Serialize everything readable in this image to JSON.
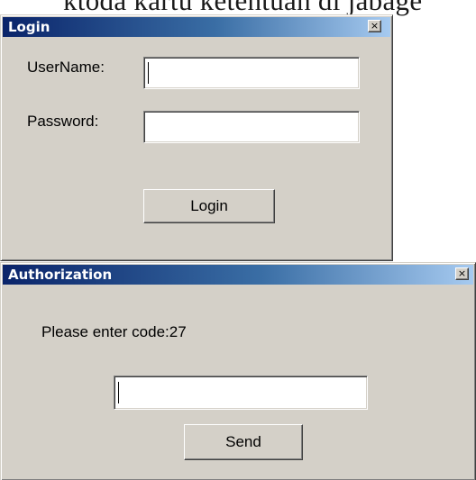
{
  "background": {
    "partial_text": "ktoda kartu ketentuan di jabage"
  },
  "login_window": {
    "title": "Login",
    "close_glyph": "×",
    "username_label": "UserName:",
    "username_value": "",
    "password_label": "Password:",
    "password_value": "",
    "login_button": "Login"
  },
  "auth_window": {
    "title": "Authorization",
    "close_glyph": "×",
    "prompt": "Please enter code:27",
    "code_value": "",
    "send_button": "Send"
  },
  "colors": {
    "window_face": "#d4d0c8",
    "titlebar_start": "#0a246a",
    "titlebar_end": "#a6caf0",
    "titlebar_text": "#ffffff"
  },
  "icons": {
    "close": "close-icon"
  }
}
